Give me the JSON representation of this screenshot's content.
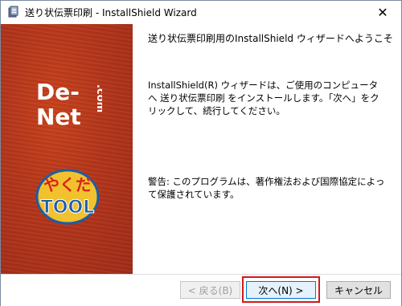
{
  "window": {
    "title": "送り状伝票印刷 - InstallShield Wizard",
    "close_glyph": "✕"
  },
  "banner": {
    "logo_brand": "De-Net.com",
    "logo_product": "やくだTOOL",
    "background_color": "#b3351a"
  },
  "content": {
    "heading": "送り状伝票印刷用のInstallShield ウィザードへようこそ",
    "paragraph1": "InstallShield(R) ウィザードは、ご使用のコンピュータへ 送り状伝票印刷 をインストールします。「次へ」をクリックして、続行してください。",
    "paragraph2": "警告: このプログラムは、著作権法および国際協定によって保護されています。"
  },
  "buttons": {
    "back": "< 戻る(B)",
    "next": "次へ(N) >",
    "cancel": "キャンセル"
  },
  "icons": {
    "title": "installer-icon",
    "close": "close-icon"
  }
}
